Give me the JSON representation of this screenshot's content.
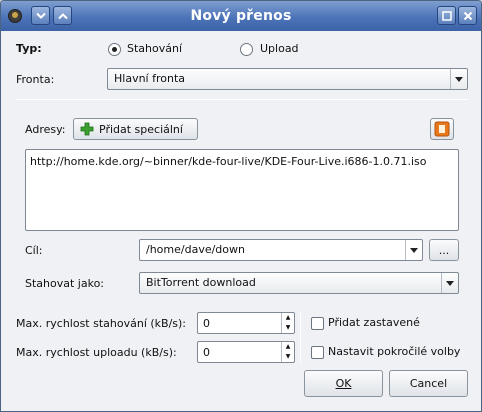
{
  "window": {
    "title": "Nový přenos"
  },
  "type": {
    "label": "Typ:",
    "options": [
      "Stahování",
      "Upload"
    ],
    "selected": "Stahování"
  },
  "queue": {
    "label": "Fronta:",
    "value": "Hlavní fronta"
  },
  "addresses": {
    "label": "Adresy:",
    "add_special_label": "Přidat speciální",
    "value": "http://home.kde.org/~binner/kde-four-live/KDE-Four-Live.i686-1.0.71.iso"
  },
  "target": {
    "label": "Cíl:",
    "value": "/home/dave/down",
    "browse_label": "..."
  },
  "download_as": {
    "label": "Stahovat jako:",
    "value": "BitTorrent download"
  },
  "speed": {
    "download_label": "Max. rychlost stahování (kB/s):",
    "download_value": "0",
    "upload_label": "Max. rychlost uploadu (kB/s):",
    "upload_value": "0"
  },
  "options": {
    "add_stopped_label": "Přidat zastavené",
    "add_stopped_checked": false,
    "advanced_label": "Nastavit pokročilé volby",
    "advanced_checked": false
  },
  "buttons": {
    "ok": "OK",
    "cancel": "Cancel"
  },
  "colors": {
    "titlebar": "#4d74b8",
    "dialog_bg": "#eff1f4",
    "add_icon": "#3aa12f",
    "clear_icon": "#e8781e"
  }
}
